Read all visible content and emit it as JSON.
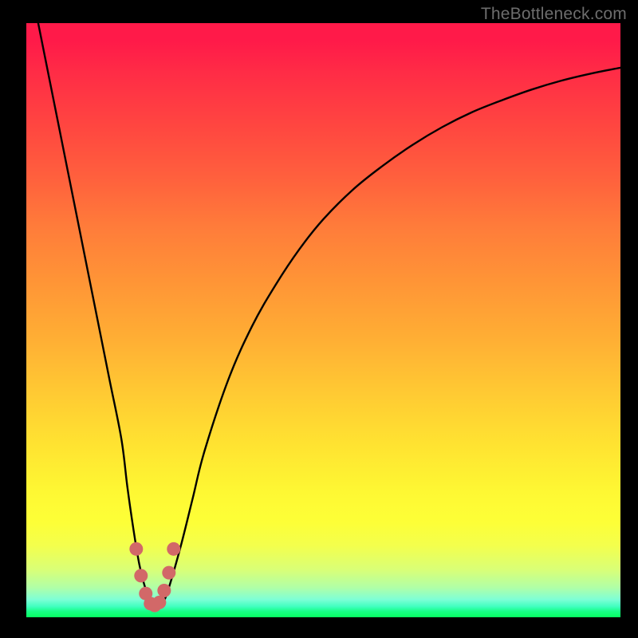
{
  "watermark": "TheBottleneck.com",
  "colors": {
    "page_bg": "#000000",
    "curve": "#000000",
    "marker": "#d26868",
    "watermark": "#6d6d6d"
  },
  "chart_data": {
    "type": "line",
    "title": "",
    "xlabel": "",
    "ylabel": "",
    "xlim": [
      0,
      100
    ],
    "ylim": [
      0,
      100
    ],
    "grid": false,
    "series": [
      {
        "name": "bottleneck-curve",
        "x": [
          0,
          2,
          4,
          6,
          8,
          10,
          12,
          14,
          16,
          17,
          18,
          19,
          20,
          21,
          22,
          23,
          24,
          26,
          28,
          30,
          34,
          38,
          42,
          46,
          50,
          55,
          60,
          65,
          70,
          75,
          80,
          85,
          90,
          95,
          100
        ],
        "values": [
          110,
          100,
          90,
          80,
          70,
          60,
          50,
          40,
          30,
          22,
          15,
          9,
          5,
          2.5,
          2,
          2.5,
          5,
          12,
          20,
          28,
          40,
          49,
          56,
          62,
          67,
          72,
          76,
          79.5,
          82.5,
          85,
          87,
          88.8,
          90.3,
          91.5,
          92.5
        ]
      }
    ],
    "markers": {
      "name": "trough-highlight",
      "x": [
        18.5,
        19.3,
        20.1,
        20.9,
        21.6,
        22.4,
        23.2,
        24.0,
        24.8
      ],
      "y": [
        11.5,
        7.0,
        4.0,
        2.3,
        2.0,
        2.5,
        4.5,
        7.5,
        11.5
      ]
    },
    "gradient_stops": [
      {
        "pos": 0.0,
        "color": "#ff1a49"
      },
      {
        "pos": 0.5,
        "color": "#ffae34"
      },
      {
        "pos": 0.82,
        "color": "#fdff37"
      },
      {
        "pos": 1.0,
        "color": "#07ff62"
      }
    ]
  }
}
